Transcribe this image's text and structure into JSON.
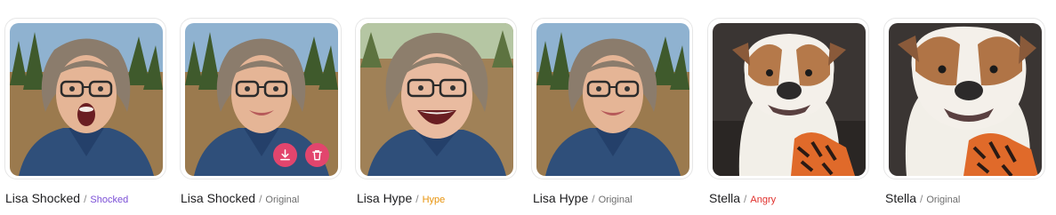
{
  "items": [
    {
      "name": "Lisa Shocked",
      "separator": "/",
      "tag": "Shocked",
      "tag_color": "#7b4fd6",
      "subject": "woman-shocked"
    },
    {
      "name": "Lisa Shocked",
      "separator": "/",
      "tag": "Original",
      "tag_color": "#6e6e6e",
      "subject": "woman-smile"
    },
    {
      "name": "Lisa Hype",
      "separator": "/",
      "tag": "Hype",
      "tag_color": "#e8930c",
      "subject": "woman-laugh"
    },
    {
      "name": "Lisa Hype",
      "separator": "/",
      "tag": "Original",
      "tag_color": "#6e6e6e",
      "subject": "woman-smile"
    },
    {
      "name": "Stella",
      "separator": "/",
      "tag": "Angry",
      "tag_color": "#e0302c",
      "subject": "bulldog"
    },
    {
      "name": "Stella",
      "separator": "/",
      "tag": "Original",
      "tag_color": "#6e6e6e",
      "subject": "bulldog-close"
    }
  ],
  "hover_actions": {
    "card_index": 1,
    "download_icon": "download-icon",
    "delete_icon": "trash-icon",
    "color": "#e2456d"
  }
}
